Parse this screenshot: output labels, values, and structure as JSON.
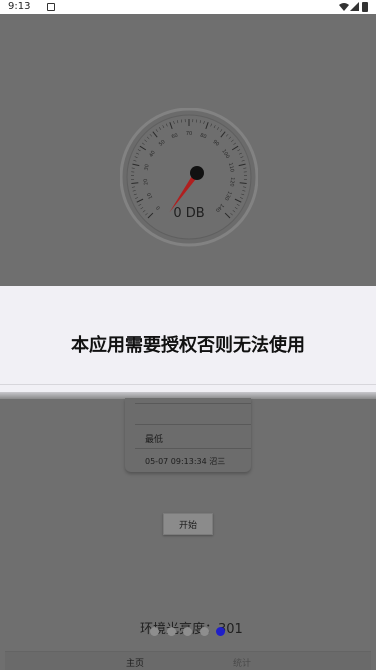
{
  "status_bar": {
    "time": "9:13",
    "icons": [
      "app-notification-icon",
      "wifi-icon",
      "signal-icon",
      "battery-icon"
    ]
  },
  "gauge": {
    "value_label": "0 DB",
    "value": 0,
    "min": 0,
    "max": 140,
    "ticks": [
      "0",
      "10",
      "20",
      "30",
      "40",
      "50",
      "60",
      "70",
      "80",
      "90",
      "100",
      "110",
      "120",
      "130",
      "140"
    ],
    "needle_color": "#b01f1f"
  },
  "modal": {
    "message": "本应用需要授权否则无法使用"
  },
  "record": {
    "label": "最低",
    "entry": "05-07 09:13:34 沼三"
  },
  "start_button": {
    "label": "开始"
  },
  "brightness": {
    "text": "环境光亮度：301"
  },
  "pager": {
    "count": 5,
    "active_index": 4,
    "active_color": "#1f1fc8"
  },
  "bottom_nav": {
    "tabs": [
      {
        "label": "主页",
        "active": true
      },
      {
        "label": "统计",
        "active": false
      }
    ]
  }
}
